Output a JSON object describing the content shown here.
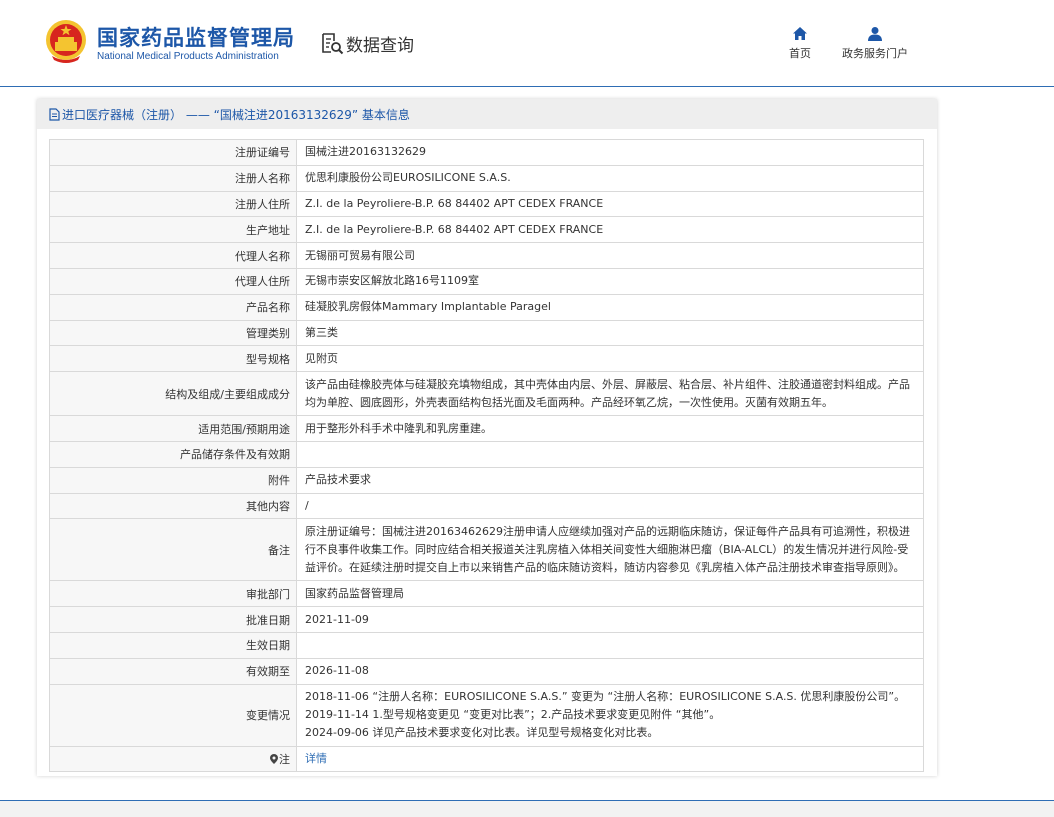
{
  "header": {
    "agency_name": "国家药品监督管理局",
    "agency_name_en": "National Medical Products Administration",
    "section_title": "数据查询",
    "nav": [
      {
        "label": "首页",
        "icon": "home-icon"
      },
      {
        "label": "政务服务门户",
        "icon": "user-icon"
      }
    ]
  },
  "panel": {
    "title": "进口医疗器械（注册） —— “国械注进20163132629” 基本信息",
    "title_icon": "document-icon"
  },
  "rows": [
    {
      "label": "注册证编号",
      "value": "国械注进20163132629"
    },
    {
      "label": "注册人名称",
      "value": "优思利康股份公司EUROSILICONE S.A.S."
    },
    {
      "label": "注册人住所",
      "value": "Z.I. de la Peyroliere-B.P. 68 84402 APT CEDEX FRANCE"
    },
    {
      "label": "生产地址",
      "value": "Z.I. de la Peyroliere-B.P. 68 84402 APT CEDEX FRANCE"
    },
    {
      "label": "代理人名称",
      "value": "无锡丽可贸易有限公司"
    },
    {
      "label": "代理人住所",
      "value": "无锡市崇安区解放北路16号1109室"
    },
    {
      "label": "产品名称",
      "value": "硅凝胶乳房假体Mammary Implantable Paragel"
    },
    {
      "label": "管理类别",
      "value": "第三类"
    },
    {
      "label": "型号规格",
      "value": "见附页"
    },
    {
      "label": "结构及组成/主要组成成分",
      "value": "该产品由硅橡胶壳体与硅凝胶充填物组成，其中壳体由内层、外层、屏蔽层、粘合层、补片组件、注胶通道密封料组成。产品均为单腔、圆底圆形，外壳表面结构包括光面及毛面两种。产品经环氧乙烷，一次性使用。灭菌有效期五年。"
    },
    {
      "label": "适用范围/预期用途",
      "value": "用于整形外科手术中隆乳和乳房重建。"
    },
    {
      "label": "产品储存条件及有效期",
      "value": ""
    },
    {
      "label": "附件",
      "value": "产品技术要求"
    },
    {
      "label": "其他内容",
      "value": "/"
    },
    {
      "label": "备注",
      "value": "原注册证编号：国械注进20163462629注册申请人应继续加强对产品的远期临床随访，保证每件产品具有可追溯性，积极进行不良事件收集工作。同时应结合相关报道关注乳房植入体相关间变性大细胞淋巴瘤（BIA-ALCL）的发生情况并进行风险-受益评价。在延续注册时提交自上市以来销售产品的临床随访资料，随访内容参见《乳房植入体产品注册技术审查指导原则》。"
    },
    {
      "label": "审批部门",
      "value": "国家药品监督管理局"
    },
    {
      "label": "批准日期",
      "value": "2021-11-09"
    },
    {
      "label": "生效日期",
      "value": ""
    },
    {
      "label": "有效期至",
      "value": "2026-11-08"
    }
  ],
  "changes": {
    "label": "变更情况",
    "lines": [
      "2018-11-06 “注册人名称：EUROSILICONE S.A.S.” 变更为 “注册人名称：EUROSILICONE S.A.S. 优思利康股份公司”。",
      "2019-11-14 1.型号规格变更见 “变更对比表”；2.产品技术要求变更见附件 “其他”。",
      "2024-09-06 详见产品技术要求变化对比表。详见型号规格变化对比表。"
    ]
  },
  "note": {
    "label": "注",
    "icon": "pin-icon",
    "link": "详情"
  },
  "colors": {
    "brand_blue": "#1d57a8",
    "link_blue": "#2e6db4",
    "emblem_red": "#d7261e",
    "emblem_gold": "#f4c430"
  }
}
